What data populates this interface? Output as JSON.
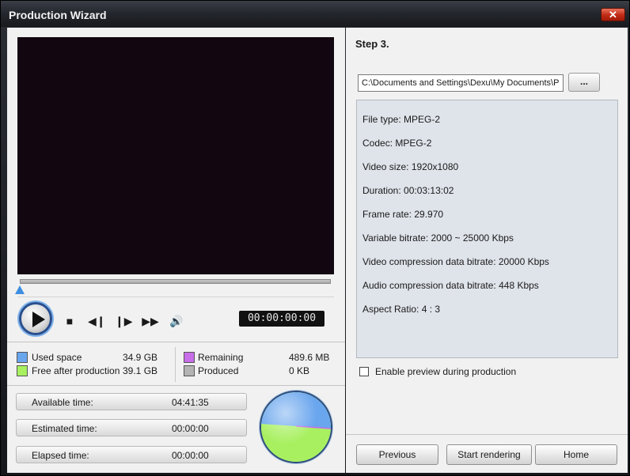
{
  "window": {
    "title": "Production Wizard",
    "close_label": "✕"
  },
  "player": {
    "timecode": "00:00:00:00",
    "progress": 0.0
  },
  "legend": {
    "used_space": {
      "label": "Used space",
      "value": "34.9 GB",
      "color": "#6aa6ee"
    },
    "free_after": {
      "label": "Free after production",
      "value": "39.1 GB",
      "color": "#a8f060"
    },
    "remaining": {
      "label": "Remaining",
      "value": "489.6 MB",
      "color": "#c76ee8"
    },
    "produced": {
      "label": "Produced",
      "value": "0 KB",
      "color": "#b4b4b4"
    }
  },
  "stats": [
    {
      "label": "Available time:",
      "value": "04:41:35"
    },
    {
      "label": "Estimated time:",
      "value": "00:00:00"
    },
    {
      "label": "Elapsed time:",
      "value": "00:00:00"
    }
  ],
  "pie_fractions": {
    "used": 0.47,
    "free": 0.53
  },
  "right": {
    "step": "Step 3.",
    "path": "C:\\Documents and Settings\\Dexu\\My Documents\\Pi",
    "browse_label": "...",
    "info": [
      "File type: MPEG-2",
      "Codec: MPEG-2",
      "Video size: 1920x1080",
      "Duration: 00:03:13:02",
      "Frame rate: 29.970",
      "Variable bitrate: 2000 ~ 25000 Kbps",
      "Video compression data bitrate: 20000 Kbps",
      "Audio compression data bitrate: 448 Kbps",
      "Aspect Ratio: 4 : 3"
    ],
    "preview_checkbox_label": "Enable preview during production",
    "preview_checked": false
  },
  "buttons": {
    "previous": "Previous",
    "start": "Start rendering",
    "home": "Home"
  }
}
